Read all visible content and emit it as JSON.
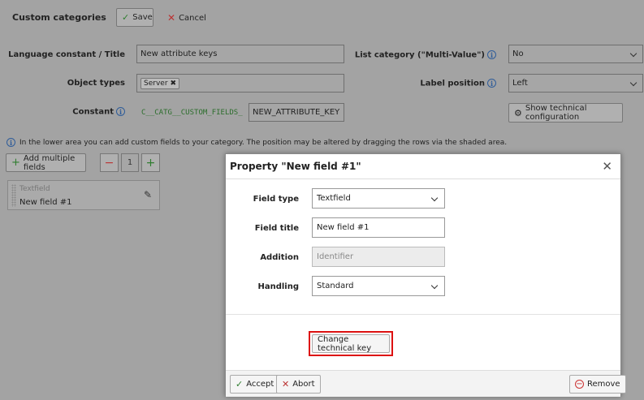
{
  "header": {
    "title": "Custom categories",
    "save_label": "Save",
    "cancel_label": "Cancel"
  },
  "form": {
    "language_constant_label": "Language constant / Title",
    "language_constant_value": "New attribute keys",
    "object_types_label": "Object types",
    "object_types_tag": "Server",
    "constant_label": "Constant",
    "constant_prefix": "C__CATG__CUSTOM_FIELDS_",
    "constant_value": "NEW_ATTRIBUTE_KEY",
    "list_category_label": "List category (\"Multi-Value\")",
    "list_category_value": "No",
    "label_position_label": "Label position",
    "label_position_value": "Left",
    "show_tech_label": "Show technical configuration"
  },
  "hint_text": "In the lower area you can add custom fields to your category. The position may be altered by dragging the rows via the shaded area.",
  "toolbar": {
    "add_multiple_label": "Add multiple fields",
    "count_value": "1"
  },
  "field_card": {
    "type": "Textfield",
    "name": "New field #1"
  },
  "modal": {
    "title": "Property \"New field #1\"",
    "field_type_label": "Field type",
    "field_type_value": "Textfield",
    "field_title_label": "Field title",
    "field_title_value": "New field #1",
    "addition_label": "Addition",
    "addition_placeholder": "Identifier",
    "handling_label": "Handling",
    "handling_value": "Standard",
    "change_key_label": "Change technical key",
    "accept_label": "Accept",
    "abort_label": "Abort",
    "remove_label": "Remove"
  },
  "colors": {
    "highlight": "#dd1111",
    "overlay": "#a3a3a3",
    "accept": "#2f7d2f",
    "abort": "#bb3333"
  }
}
